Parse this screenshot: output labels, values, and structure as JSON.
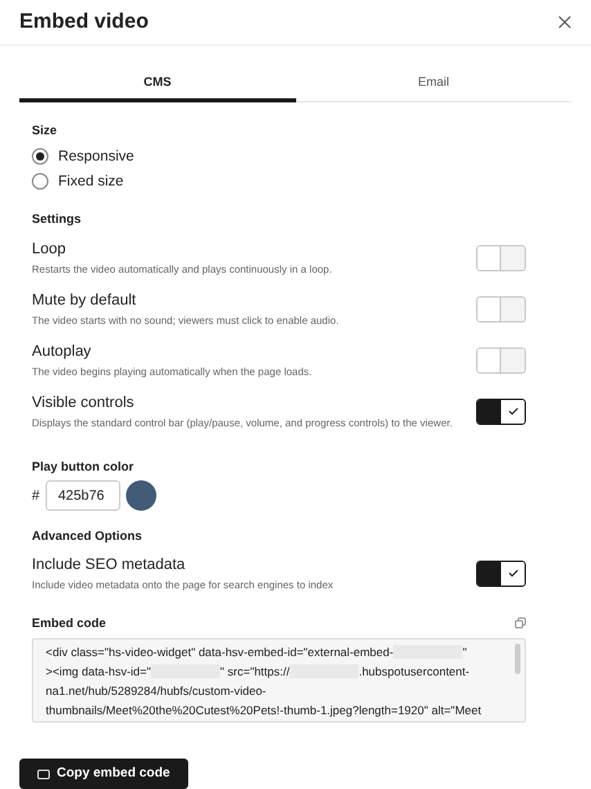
{
  "dialog": {
    "title": "Embed video"
  },
  "tabs": [
    {
      "label": "CMS",
      "selected": true
    },
    {
      "label": "Email",
      "selected": false
    }
  ],
  "size": {
    "heading": "Size",
    "options": [
      {
        "label": "Responsive",
        "selected": true
      },
      {
        "label": "Fixed size",
        "selected": false
      }
    ]
  },
  "settings": {
    "heading": "Settings",
    "items": [
      {
        "label": "Loop",
        "description": "Restarts the video automatically and plays continuously in a loop.",
        "on": false
      },
      {
        "label": "Mute by default",
        "description": "The video starts with no sound; viewers must click to enable audio.",
        "on": false
      },
      {
        "label": "Autoplay",
        "description": "The video begins playing automatically when the page loads.",
        "on": false
      },
      {
        "label": "Visible controls",
        "description": "Displays the standard control bar (play/pause, volume, and progress controls) to the viewer.",
        "on": true
      }
    ]
  },
  "play_button_color": {
    "heading": "Play button color",
    "prefix": "#",
    "value": "425b76",
    "color": "#425b76"
  },
  "advanced": {
    "heading": "Advanced Options",
    "items": [
      {
        "label": "Include SEO metadata",
        "description": "Include video metadata onto the page for search engines to index",
        "on": true
      }
    ]
  },
  "embed_code": {
    "heading": "Embed code",
    "lines": [
      [
        {
          "kind": "text",
          "text": "<div class=\"hs-video-widget\" data-hsv-embed-id=\"external-embed-"
        },
        {
          "kind": "redacted"
        },
        {
          "kind": "text",
          "text": "\""
        }
      ],
      [
        {
          "kind": "text",
          "text": "><img data-hsv-id=\""
        },
        {
          "kind": "redacted"
        },
        {
          "kind": "text",
          "text": "\" src=\"https://"
        },
        {
          "kind": "redacted"
        },
        {
          "kind": "text",
          "text": ".hubspotusercontent-"
        }
      ],
      [
        {
          "kind": "text",
          "text": "na1.net/hub/5289284/hubfs/custom-video-"
        }
      ],
      [
        {
          "kind": "text",
          "text": "thumbnails/Meet%20the%20Cutest%20Pets!-thumb-1.jpeg?length=1920\" alt=\"Meet"
        }
      ]
    ]
  },
  "copy_button": {
    "label": "Copy embed code"
  }
}
